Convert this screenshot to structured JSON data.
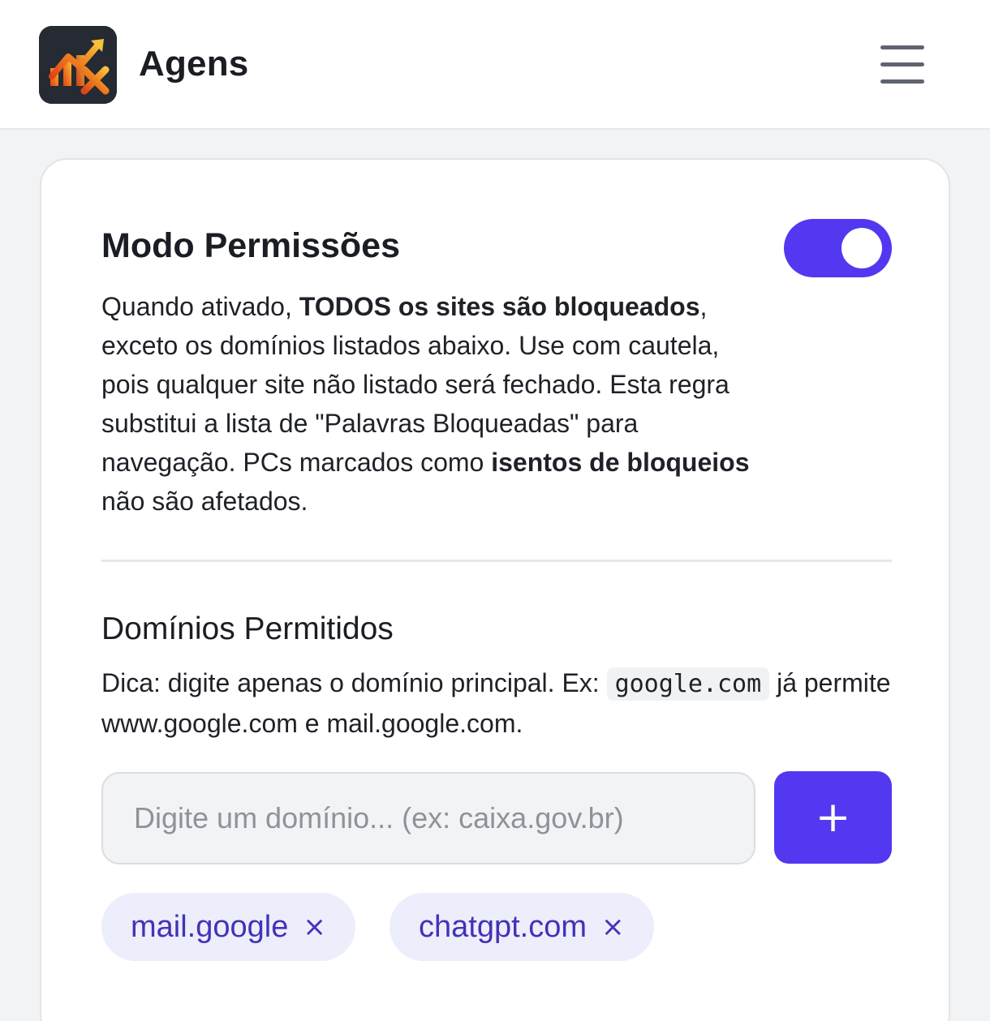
{
  "header": {
    "app_name": "Agens",
    "logo_icon": "trend-chart-logo",
    "menu_icon": "hamburger-menu-icon"
  },
  "permissions": {
    "title": "Modo Permissões",
    "toggle_on": true,
    "desc_part1": "Quando ativado, ",
    "desc_bold1": "TODOS os sites são bloqueados",
    "desc_part2": ", exceto os domínios listados abaixo. Use com cautela, pois qualquer site não listado será fechado. Esta regra substitui a lista de \"Palavras Bloqueadas\" para navegação. PCs marcados como ",
    "desc_bold2": "isentos de bloqueios",
    "desc_part3": " não são afetados."
  },
  "domains": {
    "title": "Domínios Permitidos",
    "tip_part1": "Dica: digite apenas o domínio principal. Ex: ",
    "tip_code": "google.com",
    "tip_part2": " já permite www.google.com e mail.google.com.",
    "input_placeholder": "Digite um domínio... (ex: caixa.gov.br)",
    "input_value": "",
    "add_label": "+",
    "items": [
      {
        "label": "mail.google",
        "remove": "×"
      },
      {
        "label": "chatgpt.com",
        "remove": "×"
      }
    ]
  },
  "colors": {
    "accent": "#5238f0",
    "chip_bg": "#eceefb",
    "chip_text": "#4332b8"
  }
}
